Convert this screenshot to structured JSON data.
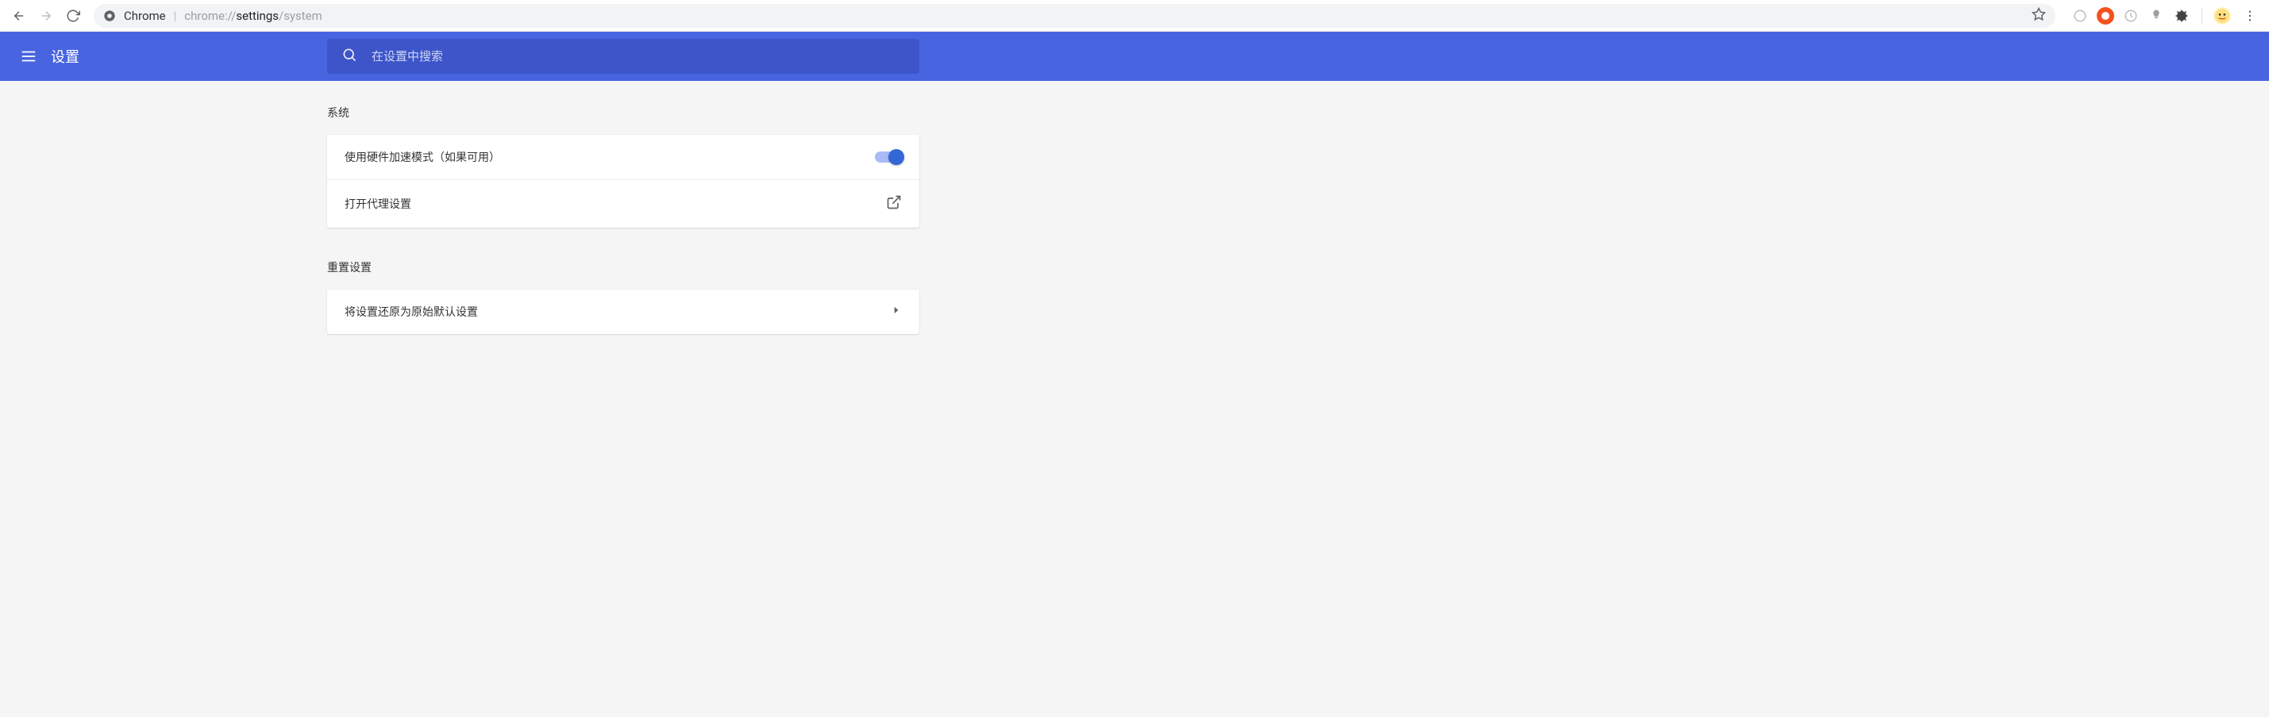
{
  "browser": {
    "brand": "Chrome",
    "url_prefix": "chrome://",
    "url_emph": "settings",
    "url_suffix": "/system"
  },
  "header": {
    "title": "设置",
    "search_placeholder": "在设置中搜索"
  },
  "sections": {
    "system": {
      "title": "系统",
      "hw_accel_label": "使用硬件加速模式（如果可用）",
      "proxy_label": "打开代理设置"
    },
    "reset": {
      "title": "重置设置",
      "restore_label": "将设置还原为原始默认设置"
    }
  }
}
